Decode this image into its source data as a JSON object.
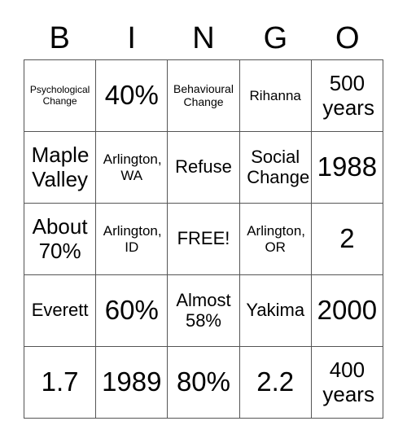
{
  "header": {
    "letters": [
      "B",
      "I",
      "N",
      "G",
      "O"
    ]
  },
  "card": {
    "rows": [
      [
        "Psychological Change",
        "40%",
        "Behavioural Change",
        "Rihanna",
        "500 years"
      ],
      [
        "Maple Valley",
        "Arlington, WA",
        "Refuse",
        "Social Change",
        "1988"
      ],
      [
        "About 70%",
        "Arlington, ID",
        "FREE!",
        "Arlington, OR",
        "2"
      ],
      [
        "Everett",
        "60%",
        "Almost 58%",
        "Yakima",
        "2000"
      ],
      [
        "1.7",
        "1989",
        "80%",
        "2.2",
        "400 years"
      ]
    ],
    "free_space": "FREE!"
  }
}
